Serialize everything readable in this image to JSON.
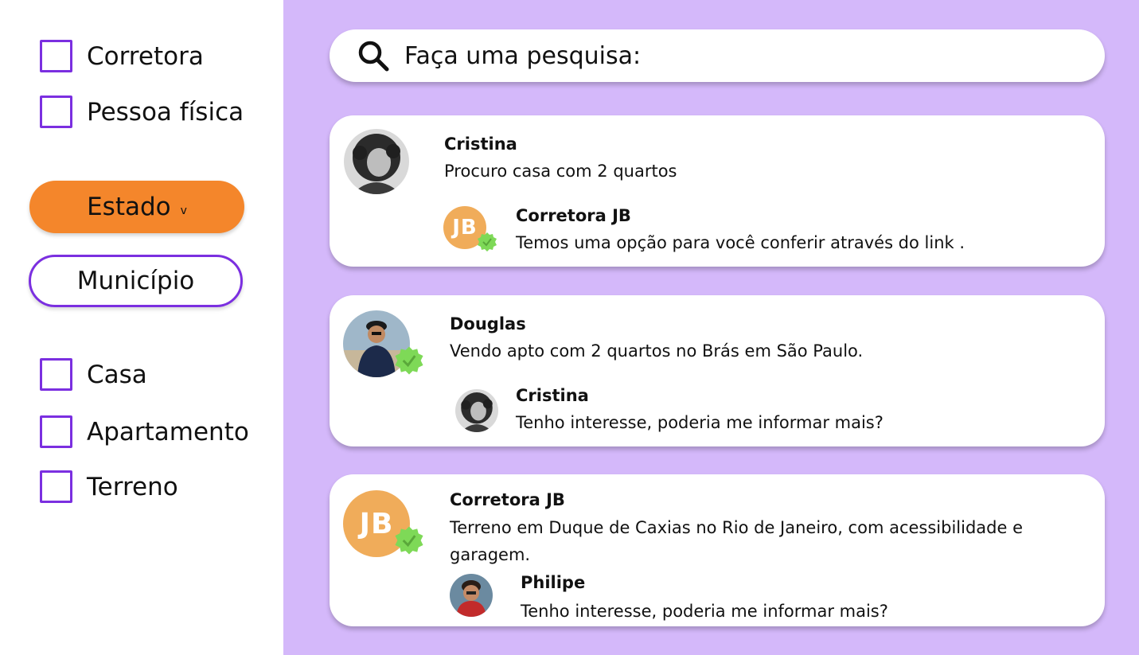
{
  "filters": {
    "type_options": [
      {
        "label": "Corretora"
      },
      {
        "label": "Pessoa física"
      }
    ],
    "estado_label": "Estado",
    "estado_chevron": "v",
    "municipio_label": "Município",
    "property_options": [
      {
        "label": "Casa"
      },
      {
        "label": "Apartamento"
      },
      {
        "label": "Terreno"
      }
    ]
  },
  "search": {
    "placeholder": "Faça uma pesquisa:"
  },
  "posts": [
    {
      "author": "Cristina",
      "text": "Procuro casa com 2 quartos",
      "reply": {
        "author": "Corretora JB",
        "avatar_initials": "JB",
        "text": "Temos uma opção para você conferir através do link ."
      }
    },
    {
      "author": "Douglas",
      "text": "Vendo apto com 2 quartos no Brás em São Paulo.",
      "reply": {
        "author": "Cristina",
        "text": "Tenho interesse, poderia me informar mais?"
      }
    },
    {
      "author": "Corretora JB",
      "avatar_initials": "JB",
      "text": "Terreno em Duque de Caxias no Rio de Janeiro, com acessibilidade e garagem.",
      "reply": {
        "author": "Philipe",
        "text": "Tenho interesse, poderia me informar mais?"
      }
    }
  ],
  "colors": {
    "accent_purple": "#7b2fe0",
    "feed_background": "#d4b8fa",
    "estado_orange": "#f4862b",
    "jb_avatar": "#f0ac5a",
    "verified_green": "#7ed957"
  },
  "icons": [
    "search-icon",
    "verified-badge-icon",
    "chevron-down-icon"
  ]
}
